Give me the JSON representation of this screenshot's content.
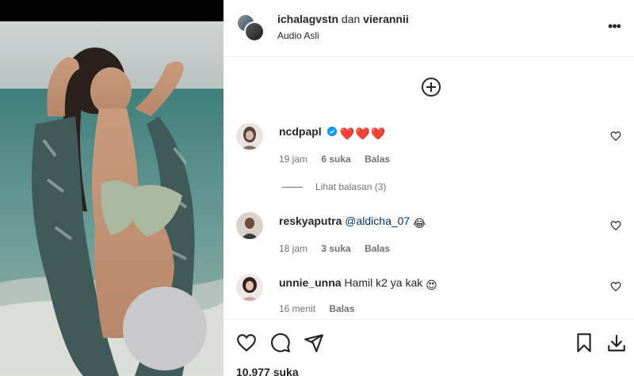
{
  "post": {
    "users": [
      "ichalagvstn",
      "vierannii"
    ],
    "connector": "dan",
    "audio": "Audio Asli",
    "likes": "10.977 suka"
  },
  "comments": [
    {
      "username": "ncdpapl",
      "verified": true,
      "text": "❤️❤️❤️",
      "time": "19 jam",
      "likes": "6 suka",
      "reply": "Balas",
      "view_replies": "Lihat balasan (3)"
    },
    {
      "username": "reskyaputra",
      "mention": "@aldicha_07",
      "text": "😂",
      "time": "18 jam",
      "likes": "3 suka",
      "reply": "Balas"
    },
    {
      "username": "unnie_unna",
      "text": "Hamil k2 ya kak",
      "emoji": "😍",
      "time": "16 menit",
      "reply": "Balas"
    }
  ],
  "colors": {
    "text": "#262626",
    "secondary": "#737373",
    "mention": "#00376b",
    "verified": "#0095f6",
    "heart": "#e0245e"
  },
  "icons": [
    "more-icon",
    "add-comment-icon",
    "heart-icon",
    "comment-icon",
    "share-icon",
    "bookmark-icon",
    "download-icon",
    "verified-icon"
  ]
}
